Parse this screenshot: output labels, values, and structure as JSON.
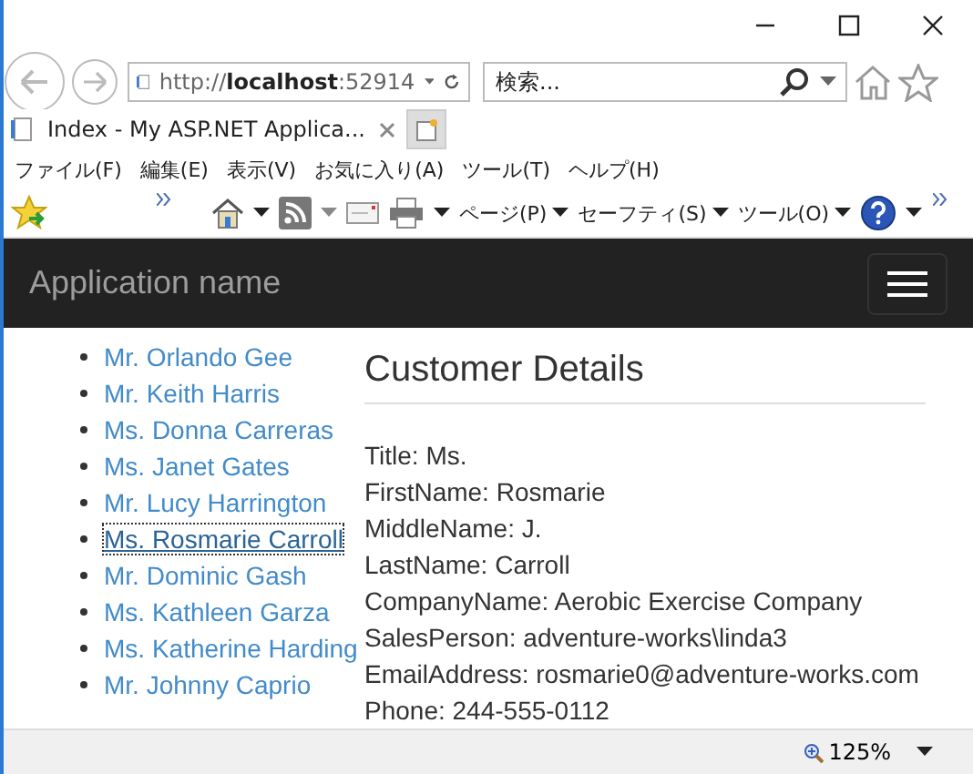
{
  "address_bar": {
    "url": "http://**localhost**:52914"
  },
  "search": {
    "placeholder": "検索..."
  },
  "tabs": [
    {
      "title": "Index - My ASP.NET Applica...",
      "selected": true
    }
  ],
  "menu_bar": [
    "ファイル(F)",
    "編集(E)",
    "表示(V)",
    "お気に入り(A)",
    "ツール(T)",
    "ヘルプ(H)"
  ],
  "command_menus": [
    "ページ(P)",
    "セーフティ(S)",
    "ツール(O)"
  ],
  "navbar": {
    "brand": "Application name"
  },
  "customers": [
    {
      "name": "Mr. Orlando Gee",
      "selected": false
    },
    {
      "name": "Mr. Keith Harris",
      "selected": false
    },
    {
      "name": "Ms. Donna Carreras",
      "selected": false
    },
    {
      "name": "Ms. Janet Gates",
      "selected": false
    },
    {
      "name": "Mr. Lucy Harrington",
      "selected": false
    },
    {
      "name": "Ms. Rosmarie Carroll",
      "selected": true
    },
    {
      "name": "Mr. Dominic Gash",
      "selected": false
    },
    {
      "name": "Ms. Kathleen Garza",
      "selected": false
    },
    {
      "name": "Ms. Katherine Harding",
      "selected": false
    },
    {
      "name": "Mr. Johnny Caprio",
      "selected": false
    }
  ],
  "details": {
    "heading": "Customer Details",
    "lines": [
      "Title: Ms.",
      "FirstName: Rosmarie",
      "MiddleName: J.",
      "LastName: Carroll",
      "CompanyName: Aerobic Exercise Company",
      "SalesPerson: adventure-works\\linda3",
      "EmailAddress: rosmarie0@adventure-works.com",
      "Phone: 244-555-0112"
    ]
  },
  "status_bar": {
    "zoom": "125%"
  }
}
